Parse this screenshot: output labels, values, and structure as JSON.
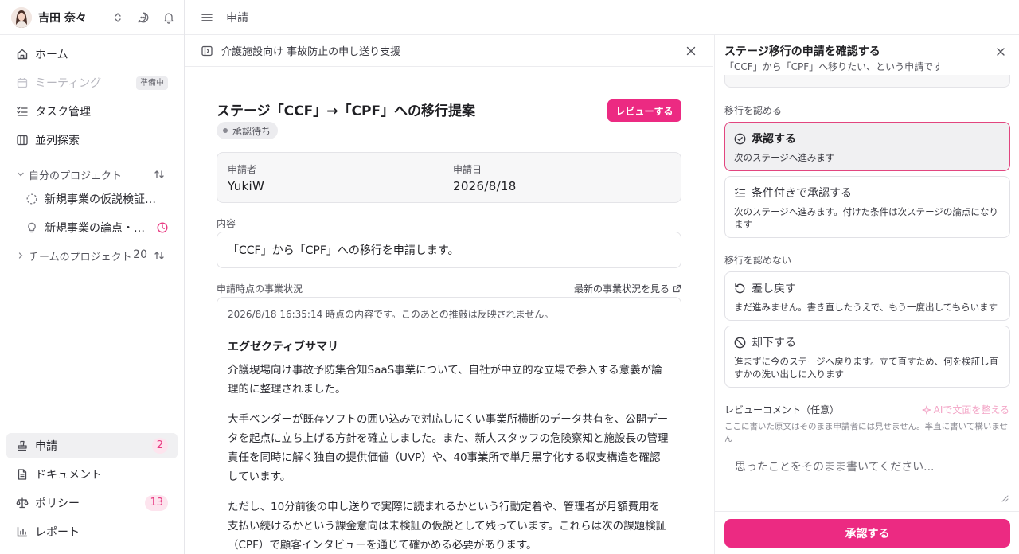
{
  "user": {
    "name": "吉田 奈々"
  },
  "nav": {
    "home": "ホーム",
    "meeting": "ミーティング",
    "meeting_tag": "準備中",
    "tasks": "タスク管理",
    "parallel": "並列探索",
    "requests": "申請",
    "requests_count": "2",
    "documents": "ドキュメント",
    "policies": "ポリシー",
    "policies_count": "13",
    "reports": "レポート"
  },
  "projects": {
    "my_section": "自分のプロジェクト",
    "items": [
      {
        "label": "新規事業の仮説検証…"
      },
      {
        "label": "新規事業の論点・…"
      }
    ],
    "team_section": "チームのプロジェクト",
    "team_count": "20"
  },
  "topbar": {
    "breadcrumb": "申請"
  },
  "document": {
    "header_title": "介護施設向け 事故防止の申し送り支援",
    "title": "ステージ「CCF」→「CPF」への移行提案",
    "review_button": "レビューする",
    "status": "承認待ち",
    "applicant_label": "申請者",
    "applicant_value": "YukiW",
    "date_label": "申請日",
    "date_value": "2026/8/18",
    "content_label": "内容",
    "content_value": "「CCF」から「CPF」への移行を申請します。",
    "snapshot_label": "申請時点の事業状況",
    "latest_link": "最新の事業状況を見る",
    "snapshot": {
      "note": "2026/8/18 16:35:14 時点の内容です。このあとの推敲は反映されません。",
      "heading": "エグゼクティブサマリ",
      "paragraphs": [
        "介護現場向け事故予防集合知SaaS事業について、自社が中立的な立場で参入する意義が論理的に整理されました。",
        "大手ベンダーが既存ソフトの囲い込みで対応しにくい事業所横断のデータ共有を、公開データを起点に立ち上げる方針を確立しました。また、新人スタッフの危険察知と施設長の管理責任を同時に解く独自の提供価値（UVP）や、40事業所で単月黒字化する収支構造を確認しています。",
        "ただし、10分前後の申し送りで実際に読まれるかという行動定着や、管理者が月額費用を支払い続けるかという課金意向は未検証の仮説として残っています。これらは次の課題検証（CPF）で顧客インタビューを通じて確かめる必要があります。"
      ]
    }
  },
  "panel": {
    "title": "ステージ移行の申請を確認する",
    "subtitle": "「CCF」から「CPF」へ移りたい、という申請です",
    "approve_group": "移行を認める",
    "reject_group": "移行を認めない",
    "options": [
      {
        "title": "承認する",
        "desc": "次のステージへ進みます"
      },
      {
        "title": "条件付きで承認する",
        "desc": "次のステージへ進みます。付けた条件は次ステージの論点になります"
      },
      {
        "title": "差し戻す",
        "desc": "まだ進みません。書き直したうえで、もう一度出してもらいます"
      },
      {
        "title": "却下する",
        "desc": "進まずに今のステージへ戻ります。立て直すため、何を検証し直すかの洗い出しに入ります"
      }
    ],
    "comment_label": "レビューコメント（任意）",
    "ai_link": "AIで文面を整える",
    "comment_help": "ここに書いた原文はそのまま申請者には見せません。率直に書いて構いません",
    "comment_placeholder": "思ったことをそのまま書いてください...",
    "submit_button": "承認する"
  }
}
